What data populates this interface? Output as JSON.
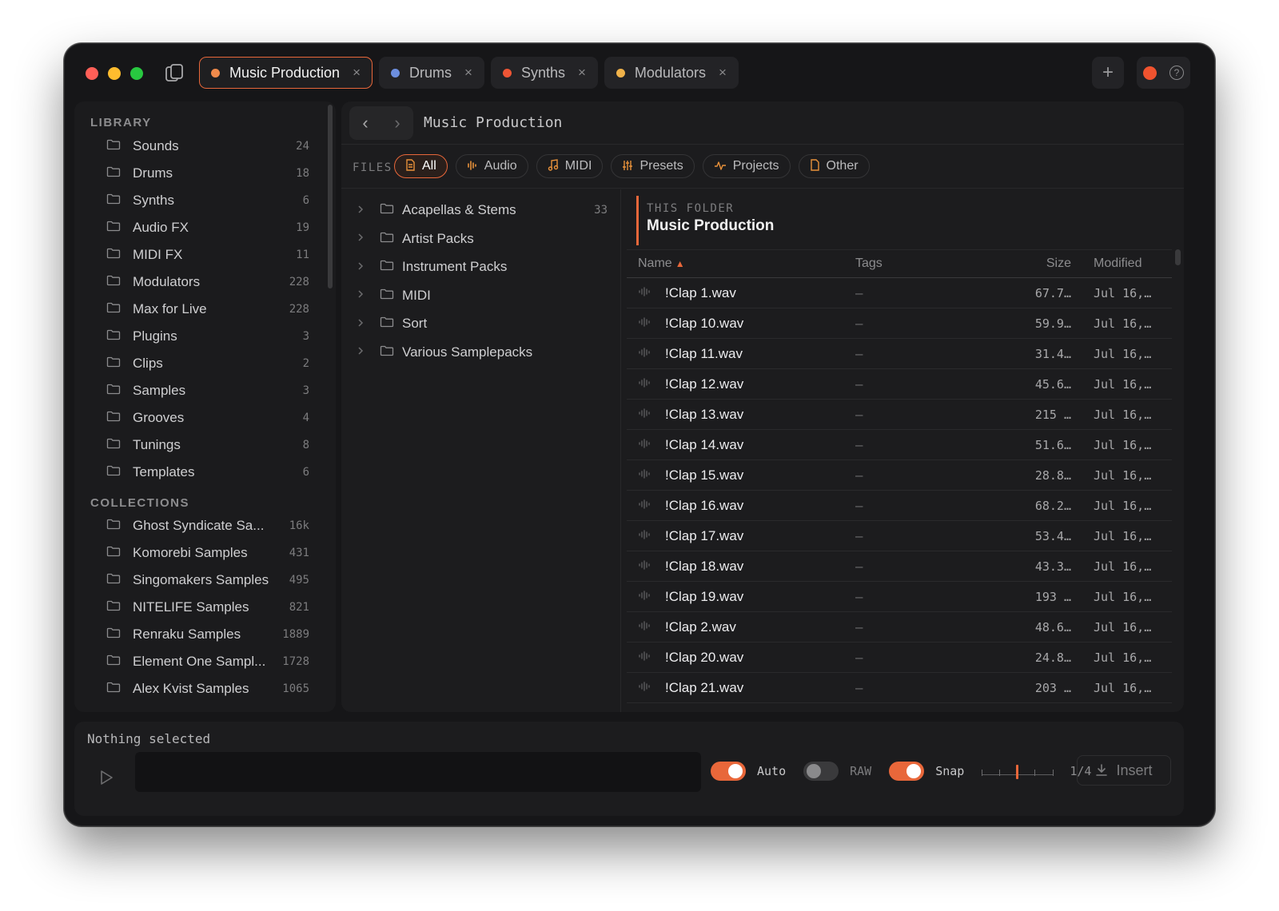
{
  "tabs": [
    {
      "label": "Music Production",
      "color": "#f08a4b",
      "active": true
    },
    {
      "label": "Drums",
      "color": "#6d8fe0",
      "active": false
    },
    {
      "label": "Synths",
      "color": "#ee5535",
      "active": false
    },
    {
      "label": "Modulators",
      "color": "#f0b24a",
      "active": false
    }
  ],
  "tab_close": "×",
  "new_tab": "+",
  "help": "?",
  "sidebar": {
    "library_heading": "LIBRARY",
    "library": [
      {
        "label": "Sounds",
        "count": "24"
      },
      {
        "label": "Drums",
        "count": "18"
      },
      {
        "label": "Synths",
        "count": "6"
      },
      {
        "label": "Audio FX",
        "count": "19"
      },
      {
        "label": "MIDI FX",
        "count": "11"
      },
      {
        "label": "Modulators",
        "count": "228"
      },
      {
        "label": "Max for Live",
        "count": "228"
      },
      {
        "label": "Plugins",
        "count": "3"
      },
      {
        "label": "Clips",
        "count": "2"
      },
      {
        "label": "Samples",
        "count": "3"
      },
      {
        "label": "Grooves",
        "count": "4"
      },
      {
        "label": "Tunings",
        "count": "8"
      },
      {
        "label": "Templates",
        "count": "6"
      }
    ],
    "collections_heading": "COLLECTIONS",
    "collections": [
      {
        "label": "Ghost Syndicate Sa...",
        "count": "16k"
      },
      {
        "label": "Komorebi Samples",
        "count": "431"
      },
      {
        "label": "Singomakers Samples",
        "count": "495"
      },
      {
        "label": "NITELIFE Samples",
        "count": "821"
      },
      {
        "label": "Renraku Samples",
        "count": "1889"
      },
      {
        "label": "Element One Sampl...",
        "count": "1728"
      },
      {
        "label": "Alex Kvist Samples",
        "count": "1065"
      }
    ]
  },
  "nav": {
    "back": "‹",
    "forward": "›",
    "breadcrumb": "Music Production"
  },
  "filters": {
    "label": "FILES",
    "chips": [
      {
        "label": "All",
        "icon": "file-icon",
        "active": true
      },
      {
        "label": "Audio",
        "icon": "audio-icon",
        "active": false
      },
      {
        "label": "MIDI",
        "icon": "midi-icon",
        "active": false
      },
      {
        "label": "Presets",
        "icon": "presets-icon",
        "active": false
      },
      {
        "label": "Projects",
        "icon": "projects-icon",
        "active": false
      },
      {
        "label": "Other",
        "icon": "other-icon",
        "active": false
      }
    ]
  },
  "tree": [
    {
      "label": "Acapellas & Stems",
      "count": "33"
    },
    {
      "label": "Artist Packs",
      "count": ""
    },
    {
      "label": "Instrument Packs",
      "count": ""
    },
    {
      "label": "MIDI",
      "count": ""
    },
    {
      "label": "Sort",
      "count": ""
    },
    {
      "label": "Various Samplepacks",
      "count": ""
    }
  ],
  "this_folder": {
    "caption": "THIS FOLDER",
    "name": "Music Production"
  },
  "table": {
    "headers": {
      "name": "Name",
      "tags": "Tags",
      "size": "Size",
      "modified": "Modified"
    },
    "sort_indicator": "▲",
    "rows": [
      {
        "name": "!Clap 1.wav",
        "tags": "–",
        "size": "67.7…",
        "modified": "Jul 16,…"
      },
      {
        "name": "!Clap 10.wav",
        "tags": "–",
        "size": "59.9…",
        "modified": "Jul 16,…"
      },
      {
        "name": "!Clap 11.wav",
        "tags": "–",
        "size": "31.4…",
        "modified": "Jul 16,…"
      },
      {
        "name": "!Clap 12.wav",
        "tags": "–",
        "size": "45.6…",
        "modified": "Jul 16,…"
      },
      {
        "name": "!Clap 13.wav",
        "tags": "–",
        "size": "215 …",
        "modified": "Jul 16,…"
      },
      {
        "name": "!Clap 14.wav",
        "tags": "–",
        "size": "51.6…",
        "modified": "Jul 16,…"
      },
      {
        "name": "!Clap 15.wav",
        "tags": "–",
        "size": "28.8…",
        "modified": "Jul 16,…"
      },
      {
        "name": "!Clap 16.wav",
        "tags": "–",
        "size": "68.2…",
        "modified": "Jul 16,…"
      },
      {
        "name": "!Clap 17.wav",
        "tags": "–",
        "size": "53.4…",
        "modified": "Jul 16,…"
      },
      {
        "name": "!Clap 18.wav",
        "tags": "–",
        "size": "43.3…",
        "modified": "Jul 16,…"
      },
      {
        "name": "!Clap 19.wav",
        "tags": "–",
        "size": "193 …",
        "modified": "Jul 16,…"
      },
      {
        "name": "!Clap 2.wav",
        "tags": "–",
        "size": "48.6…",
        "modified": "Jul 16,…"
      },
      {
        "name": "!Clap 20.wav",
        "tags": "–",
        "size": "24.8…",
        "modified": "Jul 16,…"
      },
      {
        "name": "!Clap 21.wav",
        "tags": "–",
        "size": "203 …",
        "modified": "Jul 16,…"
      }
    ]
  },
  "bottom": {
    "status": "Nothing selected",
    "auto_label": "Auto",
    "auto_on": true,
    "raw_label": "RAW",
    "raw_on": false,
    "snap_label": "Snap",
    "snap_on": true,
    "snap_value": "1/4",
    "insert_label": "Insert"
  },
  "colors": {
    "accent": "#e8673a"
  }
}
